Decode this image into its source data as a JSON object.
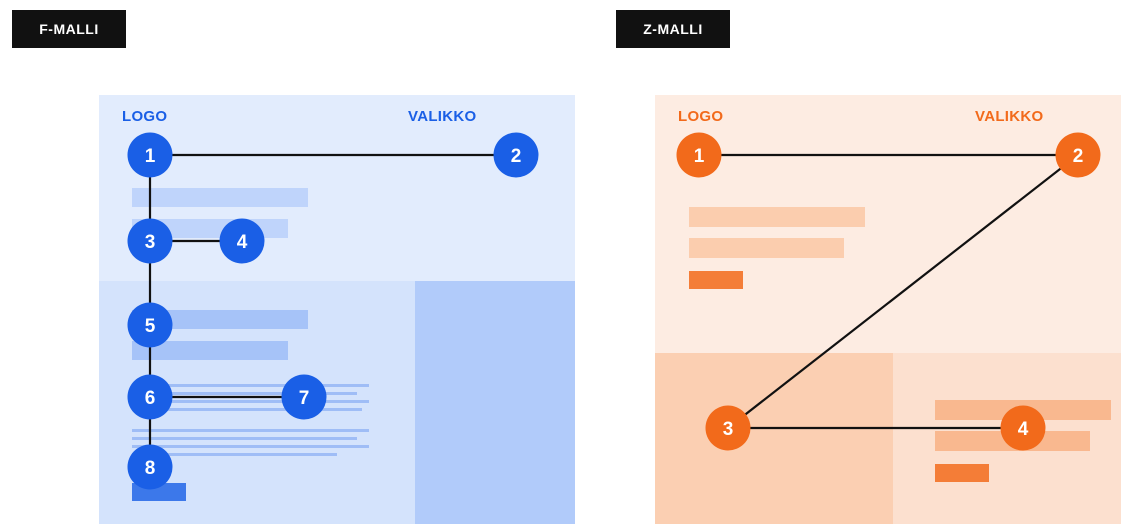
{
  "f_panel": {
    "tag": "F-MALLI",
    "logo_label": "LOGO",
    "menu_label": "VALIKKO",
    "accent": "#1a5fe6",
    "nodes": [
      "1",
      "2",
      "3",
      "4",
      "5",
      "6",
      "7",
      "8"
    ]
  },
  "z_panel": {
    "tag": "Z-MALLI",
    "logo_label": "LOGO",
    "menu_label": "VALIKKO",
    "accent": "#f26a1b",
    "nodes": [
      "1",
      "2",
      "3",
      "4"
    ]
  }
}
